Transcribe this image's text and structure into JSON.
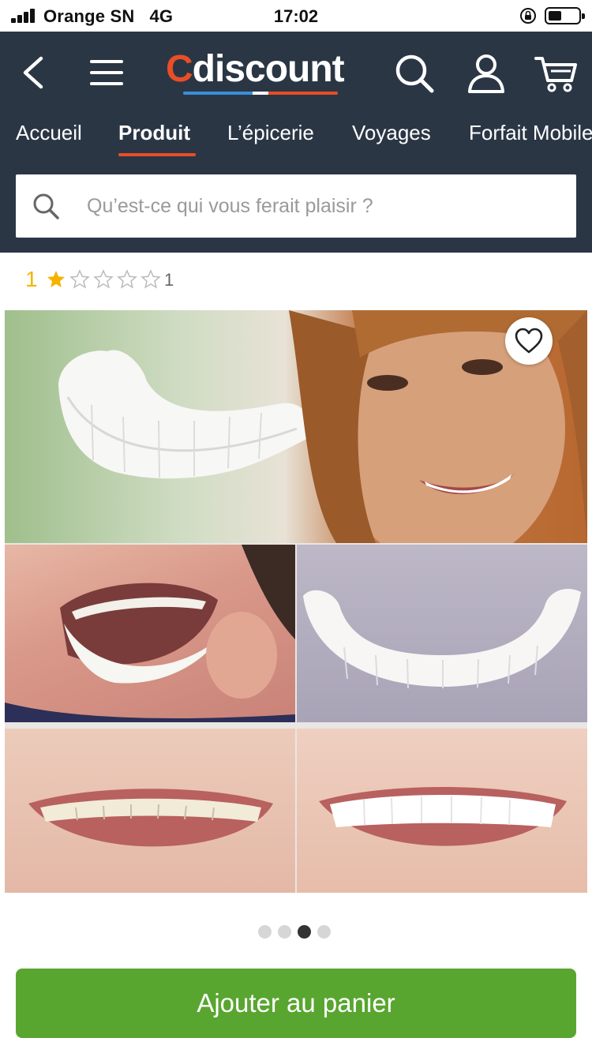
{
  "status_bar": {
    "carrier": "Orange SN",
    "network": "4G",
    "time": "17:02",
    "signal_bars": 4,
    "battery_level": 0.45
  },
  "header": {
    "logo": "Cdiscount",
    "icons": [
      "back-icon",
      "menu-icon",
      "search-icon",
      "user-icon",
      "cart-icon"
    ],
    "colors": {
      "background": "#2b3645",
      "accent": "#e94e26"
    }
  },
  "nav": {
    "items": [
      {
        "label": "Accueil",
        "active": false
      },
      {
        "label": "Produit",
        "active": true
      },
      {
        "label": "L’épicerie",
        "active": false
      },
      {
        "label": "Voyages",
        "active": false
      },
      {
        "label": "Forfait Mobile",
        "active": false
      }
    ]
  },
  "search": {
    "placeholder": "Qu’est-ce qui vous ferait plaisir ?",
    "value": ""
  },
  "rating": {
    "score": "1",
    "stars_filled": 1,
    "stars_total": 5,
    "count": "1",
    "star_color": "#f5b400"
  },
  "product": {
    "favorite_icon": "heart-outline-icon",
    "gallery": {
      "current_page": 3,
      "total_pages": 4
    }
  },
  "cta": {
    "label": "Ajouter au panier",
    "color": "#58a62f"
  }
}
